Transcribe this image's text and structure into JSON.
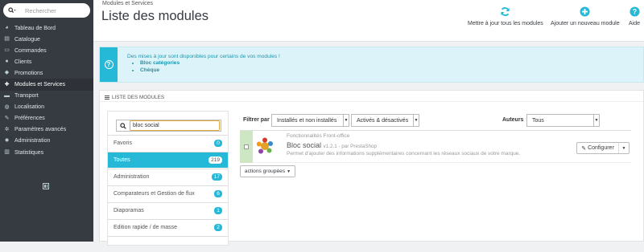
{
  "sidebar": {
    "search_placeholder": "Rechercher",
    "items": [
      {
        "label": "Tableau de Bord",
        "icon": "dashboard-icon"
      },
      {
        "label": "Catalogue",
        "icon": "catalog-icon"
      },
      {
        "label": "Commandes",
        "icon": "orders-icon"
      },
      {
        "label": "Clients",
        "icon": "customers-icon"
      },
      {
        "label": "Promotions",
        "icon": "promotions-icon"
      },
      {
        "label": "Modules et Services",
        "icon": "modules-icon",
        "active": true
      },
      {
        "label": "Transport",
        "icon": "truck-icon"
      },
      {
        "label": "Localisation",
        "icon": "globe-icon"
      },
      {
        "label": "Préférences",
        "icon": "wrench-icon"
      },
      {
        "label": "Paramètres avancés",
        "icon": "cogs-icon"
      },
      {
        "label": "Administration",
        "icon": "gear-icon"
      },
      {
        "label": "Statistiques",
        "icon": "stats-icon"
      }
    ]
  },
  "header": {
    "breadcrumb": "Modules et Services",
    "title": "Liste des modules",
    "toolbar": {
      "update_all": "Mettre à jour tous les modules",
      "add_module": "Ajouter un nouveau module",
      "help": "Aide"
    }
  },
  "alert": {
    "message": "Des mises à jour sont disponibles pour certains de vos modules !",
    "items": [
      "Bloc catégories",
      "Chèque"
    ]
  },
  "panel": {
    "title": "LISTE DES MODULES",
    "search_value": "bloc social",
    "categories": [
      {
        "label": "Favoris",
        "count": "0"
      },
      {
        "label": "Toutes",
        "count": "219",
        "active": true
      },
      {
        "label": "Administration",
        "count": "17"
      },
      {
        "label": "Comparateurs et Gestion de flux",
        "count": "6"
      },
      {
        "label": "Diaporamas",
        "count": "1"
      },
      {
        "label": "Edition rapide / de masse",
        "count": "2"
      }
    ],
    "filter": {
      "label": "Filtrer par",
      "installed": "Installés et non installés",
      "enabled": "Activés & désactivés",
      "authors_label": "Auteurs",
      "authors": "Tous"
    },
    "module": {
      "category": "Fonctionnalités Front-office",
      "name": "Bloc social",
      "version": "v1.2.1 - par PrestaShop",
      "description": "Permet d'ajouter des informations supplémentaires concernant les réseaux sociaux de votre marque.",
      "configure": "Configurer"
    },
    "bulk_actions": "actions groupées"
  },
  "colors": {
    "sidebar_bg": "#363a41",
    "accent": "#25b9d7",
    "alert_bg": "#dcf4f9"
  }
}
